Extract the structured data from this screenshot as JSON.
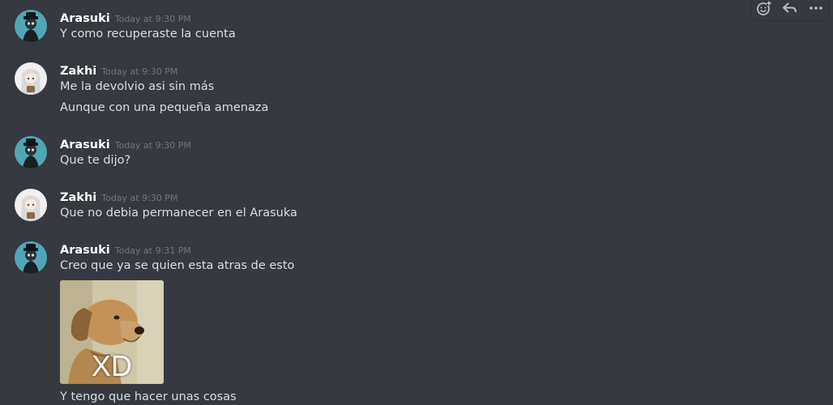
{
  "colors": {
    "background": "#36393f",
    "username": "#ffffff",
    "timestamp": "#72767d",
    "message_text": "#dcddde"
  },
  "toolbar": {
    "icons": [
      "add-reaction-icon",
      "reply-icon",
      "more-icon"
    ]
  },
  "messages": [
    {
      "author": "Arasuki",
      "timestamp": "Today at 9:30 PM",
      "avatar": "arasuki-avatar",
      "lines": [
        "Y como recuperaste la cuenta"
      ]
    },
    {
      "author": "Zakhi",
      "timestamp": "Today at 9:30 PM",
      "avatar": "zakhi-avatar",
      "lines": [
        "Me la devolvio asi sin más",
        "Aunque con una pequeña amenaza"
      ]
    },
    {
      "author": "Arasuki",
      "timestamp": "Today at 9:30 PM",
      "avatar": "arasuki-avatar",
      "lines": [
        "Que te dijo?"
      ]
    },
    {
      "author": "Zakhi",
      "timestamp": "Today at 9:30 PM",
      "avatar": "zakhi-avatar",
      "lines": [
        "Que no debia permanecer en el Arasuka"
      ]
    },
    {
      "author": "Arasuki",
      "timestamp": "Today at 9:31 PM",
      "avatar": "arasuki-avatar",
      "lines": [
        "Creo que ya se quien esta atras de esto",
        "Y tengo que hacer unas cosas"
      ],
      "attachment": {
        "type": "image",
        "caption": "XD"
      }
    }
  ]
}
